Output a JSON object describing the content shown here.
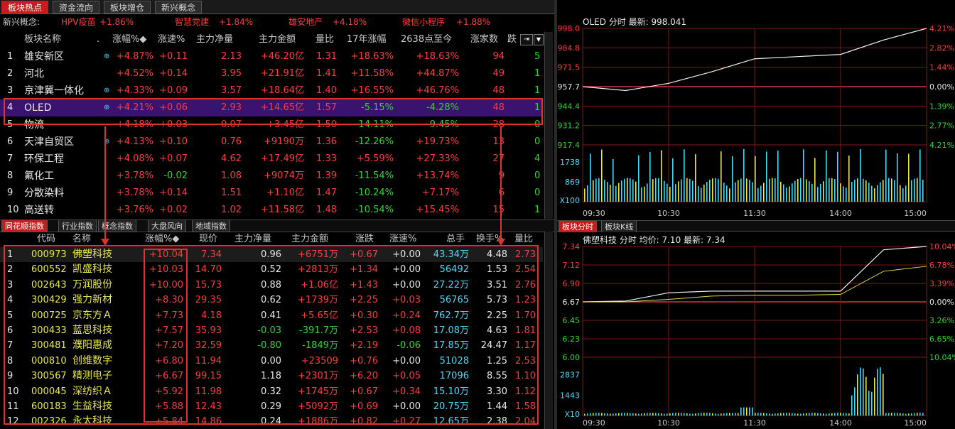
{
  "top_tabs": [
    "板块热点",
    "资金流向",
    "板块增仓",
    "新兴概念"
  ],
  "concept_bar": {
    "label": "新兴概念:",
    "items": [
      {
        "name": "HPV疫苗",
        "chg": "+1.86%"
      },
      {
        "name": "智慧党建",
        "chg": "+1.84%"
      },
      {
        "name": "雄安地产",
        "chg": "+4.18%"
      },
      {
        "name": "微信小程序",
        "chg": "+1.88%"
      }
    ]
  },
  "sector_table": {
    "headers": [
      "板块名称",
      ".",
      "涨幅%◆",
      "涨速%",
      "主力净量",
      "主力金额",
      "量比",
      "17年涨幅",
      "2638点至今",
      "涨家数",
      "跌"
    ],
    "rows": [
      {
        "no": "1",
        "name": "雄安新区",
        "plus": "⊕",
        "chg": "+4.87%",
        "speed": "+0.11",
        "net": "2.13",
        "amt": "+46.20亿",
        "ratio": "1.31",
        "y17": "+18.63%",
        "since": "+18.63%",
        "up": "94",
        "down": "5"
      },
      {
        "no": "2",
        "name": "河北",
        "plus": "",
        "chg": "+4.52%",
        "speed": "+0.14",
        "net": "3.95",
        "amt": "+21.91亿",
        "ratio": "1.41",
        "y17": "+11.58%",
        "since": "+44.87%",
        "up": "49",
        "down": "1"
      },
      {
        "no": "3",
        "name": "京津冀一体化",
        "plus": "⊕",
        "chg": "+4.33%",
        "speed": "+0.09",
        "net": "3.57",
        "amt": "+18.64亿",
        "ratio": "1.40",
        "y17": "+16.55%",
        "since": "+46.76%",
        "up": "48",
        "down": "1"
      },
      {
        "no": "4",
        "name": "OLED",
        "plus": "⊕",
        "chg": "+4.21%",
        "speed": "+0.06",
        "net": "2.93",
        "amt": "+14.65亿",
        "ratio": "1.57",
        "y17": "-5.15%",
        "since": "-4.28%",
        "up": "48",
        "down": "1"
      },
      {
        "no": "5",
        "name": "物流",
        "plus": "",
        "chg": "+4.18%",
        "speed": "+0.03",
        "net": "0.07",
        "amt": "+3.45亿",
        "ratio": "1.50",
        "y17": "-14.11%",
        "since": "-9.45%",
        "up": "28",
        "down": "0"
      },
      {
        "no": "6",
        "name": "天津自贸区",
        "plus": "⊕",
        "chg": "+4.13%",
        "speed": "+0.10",
        "net": "0.76",
        "amt": "+9190万",
        "ratio": "1.36",
        "y17": "-12.26%",
        "since": "+19.73%",
        "up": "13",
        "down": "0"
      },
      {
        "no": "7",
        "name": "环保工程",
        "plus": "",
        "chg": "+4.08%",
        "speed": "+0.07",
        "net": "4.62",
        "amt": "+17.49亿",
        "ratio": "1.33",
        "y17": "+5.59%",
        "since": "+27.33%",
        "up": "27",
        "down": "4"
      },
      {
        "no": "8",
        "name": "氟化工",
        "plus": "",
        "chg": "+3.78%",
        "speed": "-0.02",
        "net": "1.08",
        "amt": "+9074万",
        "ratio": "1.39",
        "y17": "-11.54%",
        "since": "+13.74%",
        "up": "9",
        "down": "0"
      },
      {
        "no": "9",
        "name": "分散染料",
        "plus": "",
        "chg": "+3.78%",
        "speed": "+0.14",
        "net": "1.51",
        "amt": "+1.10亿",
        "ratio": "1.47",
        "y17": "-10.24%",
        "since": "+7.17%",
        "up": "6",
        "down": "0"
      },
      {
        "no": "10",
        "name": "高送转",
        "plus": "",
        "chg": "+3.76%",
        "speed": "+0.02",
        "net": "1.02",
        "amt": "+11.58亿",
        "ratio": "1.48",
        "y17": "-10.54%",
        "since": "+15.45%",
        "up": "15",
        "down": "1"
      }
    ]
  },
  "mid_tabs": [
    "同花顺指数",
    "行业指数",
    "概念指数",
    "大盘风向",
    "地域指数"
  ],
  "stock_table": {
    "headers": [
      "代码",
      "名称",
      "涨幅%◆",
      "现价",
      "主力净量",
      "主力金额",
      "涨跌",
      "涨速%",
      "总手",
      "换手%",
      "量比"
    ],
    "rows": [
      {
        "no": "1",
        "code": "000973",
        "name": "佛塑科技",
        "chg": "+10.04",
        "price": "7.34",
        "net": "0.96",
        "amt": "+6751万",
        "diff": "+0.67",
        "speed": "+0.00",
        "vol": "43.34万",
        "turn": "4.48",
        "ratio": "2.73"
      },
      {
        "no": "2",
        "code": "600552",
        "name": "凯盛科技",
        "chg": "+10.03",
        "price": "14.70",
        "net": "0.52",
        "amt": "+2813万",
        "diff": "+1.34",
        "speed": "+0.00",
        "vol": "56492",
        "turn": "1.53",
        "ratio": "2.54"
      },
      {
        "no": "3",
        "code": "002643",
        "name": "万润股份",
        "chg": "+10.00",
        "price": "15.73",
        "net": "0.88",
        "amt": "+1.06亿",
        "diff": "+1.43",
        "speed": "+0.00",
        "vol": "27.22万",
        "turn": "3.51",
        "ratio": "2.76"
      },
      {
        "no": "4",
        "code": "300429",
        "name": "强力新材",
        "chg": "+8.30",
        "price": "29.35",
        "net": "0.62",
        "amt": "+1739万",
        "diff": "+2.25",
        "speed": "+0.03",
        "vol": "56765",
        "turn": "5.73",
        "ratio": "1.23"
      },
      {
        "no": "5",
        "code": "000725",
        "name": "京东方Ａ",
        "chg": "+7.73",
        "price": "4.18",
        "net": "0.41",
        "amt": "+5.65亿",
        "diff": "+0.30",
        "speed": "+0.24",
        "vol": "762.7万",
        "turn": "2.25",
        "ratio": "1.70"
      },
      {
        "no": "6",
        "code": "300433",
        "name": "蓝思科技",
        "chg": "+7.57",
        "price": "35.93",
        "net": "-0.03",
        "amt": "-391.7万",
        "diff": "+2.53",
        "speed": "+0.08",
        "vol": "17.08万",
        "turn": "4.63",
        "ratio": "1.81"
      },
      {
        "no": "7",
        "code": "300481",
        "name": "濮阳惠成",
        "chg": "+7.20",
        "price": "32.59",
        "net": "-0.80",
        "amt": "-1849万",
        "diff": "+2.19",
        "speed": "-0.06",
        "vol": "17.85万",
        "turn": "24.47",
        "ratio": "1.17"
      },
      {
        "no": "8",
        "code": "000810",
        "name": "创维数字",
        "chg": "+6.80",
        "price": "11.94",
        "net": "0.00",
        "amt": "+23509",
        "diff": "+0.76",
        "speed": "+0.00",
        "vol": "51028",
        "turn": "1.25",
        "ratio": "2.53"
      },
      {
        "no": "9",
        "code": "300567",
        "name": "精测电子",
        "chg": "+6.67",
        "price": "99.15",
        "net": "1.18",
        "amt": "+2301万",
        "diff": "+6.20",
        "speed": "+0.05",
        "vol": "17096",
        "turn": "8.55",
        "ratio": "1.10"
      },
      {
        "no": "10",
        "code": "000045",
        "name": "深纺织Ａ",
        "chg": "+5.92",
        "price": "11.98",
        "net": "0.32",
        "amt": "+1745万",
        "diff": "+0.67",
        "speed": "+0.34",
        "vol": "15.10万",
        "turn": "3.30",
        "ratio": "1.12"
      },
      {
        "no": "11",
        "code": "600183",
        "name": "生益科技",
        "chg": "+5.88",
        "price": "12.43",
        "net": "0.29",
        "amt": "+5092万",
        "diff": "+0.69",
        "speed": "+0.00",
        "vol": "20.75万",
        "turn": "1.44",
        "ratio": "1.58"
      },
      {
        "no": "12",
        "code": "002326",
        "name": "永太科技",
        "chg": "+5.84",
        "price": "14.86",
        "net": "0.24",
        "amt": "+1886万",
        "diff": "+0.82",
        "speed": "+0.27",
        "vol": "12.65万",
        "turn": "2.38",
        "ratio": "2.04"
      }
    ]
  },
  "chart_top": {
    "title": "OLED 分时 最新: 998.041",
    "price_labels": [
      "998.0",
      "984.8",
      "971.5",
      "957.7",
      "944.4",
      "931.2",
      "917.4"
    ],
    "pct_labels": [
      "4.21%",
      "2.82%",
      "1.44%",
      "0.00%",
      "1.39%",
      "2.77%",
      "4.21%"
    ],
    "vol_labels": [
      "1738",
      "869",
      "X100"
    ],
    "time_labels": [
      "09:30",
      "10:30",
      "11:30",
      "14:00",
      "15:00"
    ],
    "tabs": [
      "板块分时",
      "板块K线"
    ]
  },
  "chart_bottom": {
    "title": "佛塑科技 分时 均价: 7.10 最新: 7.34",
    "price_labels": [
      "7.34",
      "7.12",
      "6.90",
      "6.67",
      "6.45",
      "6.23",
      "6.00"
    ],
    "pct_labels": [
      "10.04%",
      "6.78%",
      "3.39%",
      "0.00%",
      "3.26%",
      "6.65%",
      "10.04%"
    ],
    "vol_labels": [
      "2837",
      "1443",
      "X10"
    ],
    "time_labels": [
      "09:30",
      "10:30",
      "11:30",
      "14:00",
      "15:00"
    ]
  },
  "chart_data": [
    {
      "type": "line",
      "title": "OLED 分时 最新: 998.041",
      "x": [
        "09:30",
        "10:00",
        "10:30",
        "11:00",
        "11:30",
        "13:30",
        "14:00",
        "14:30",
        "15:00"
      ],
      "series": [
        {
          "values": [
            957.7,
            955.0,
            960.0,
            968.0,
            977.0,
            978.5,
            980.0,
            990.0,
            998.0
          ]
        }
      ],
      "ylim": [
        917.4,
        998.0
      ]
    },
    {
      "type": "line",
      "title": "佛塑科技 分时 均价: 7.10 最新: 7.34",
      "x": [
        "09:30",
        "10:00",
        "10:30",
        "11:00",
        "11:30",
        "13:30",
        "14:00",
        "14:30",
        "15:00"
      ],
      "series": [
        {
          "values": [
            6.67,
            6.68,
            6.78,
            6.8,
            6.8,
            6.8,
            6.8,
            7.3,
            7.34
          ]
        }
      ],
      "ylim": [
        6.0,
        7.34
      ]
    }
  ]
}
